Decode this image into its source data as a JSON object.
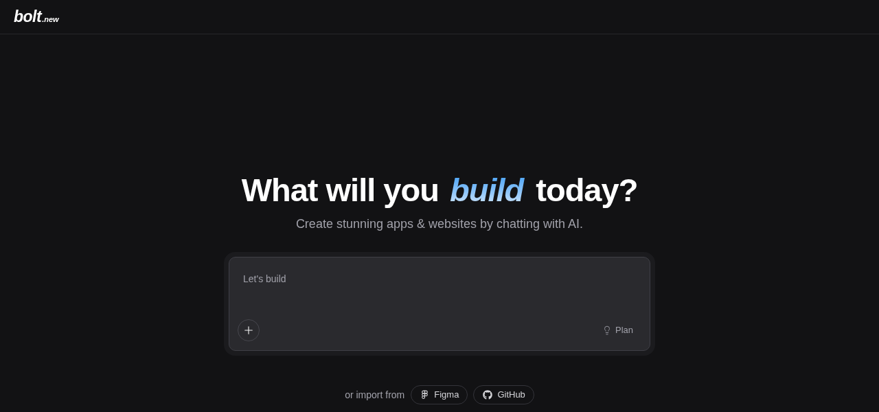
{
  "header": {
    "logo": {
      "wordmark": "bolt",
      "suffix": ".new"
    }
  },
  "hero": {
    "heading": "What will you *build* today?",
    "subtitle": "Create stunning apps & websites by chatting with AI."
  },
  "prompt": {
    "placeholder": "Let's build",
    "actions": [
      {
        "kind": "add"
      },
      {
        "kind": "plan",
        "label": "Plan"
      }
    ]
  },
  "import": {
    "label": "or import from",
    "sources": [
      {
        "kind": "figma",
        "label": "Figma"
      },
      {
        "kind": "github",
        "label": "GitHub"
      }
    ]
  }
}
